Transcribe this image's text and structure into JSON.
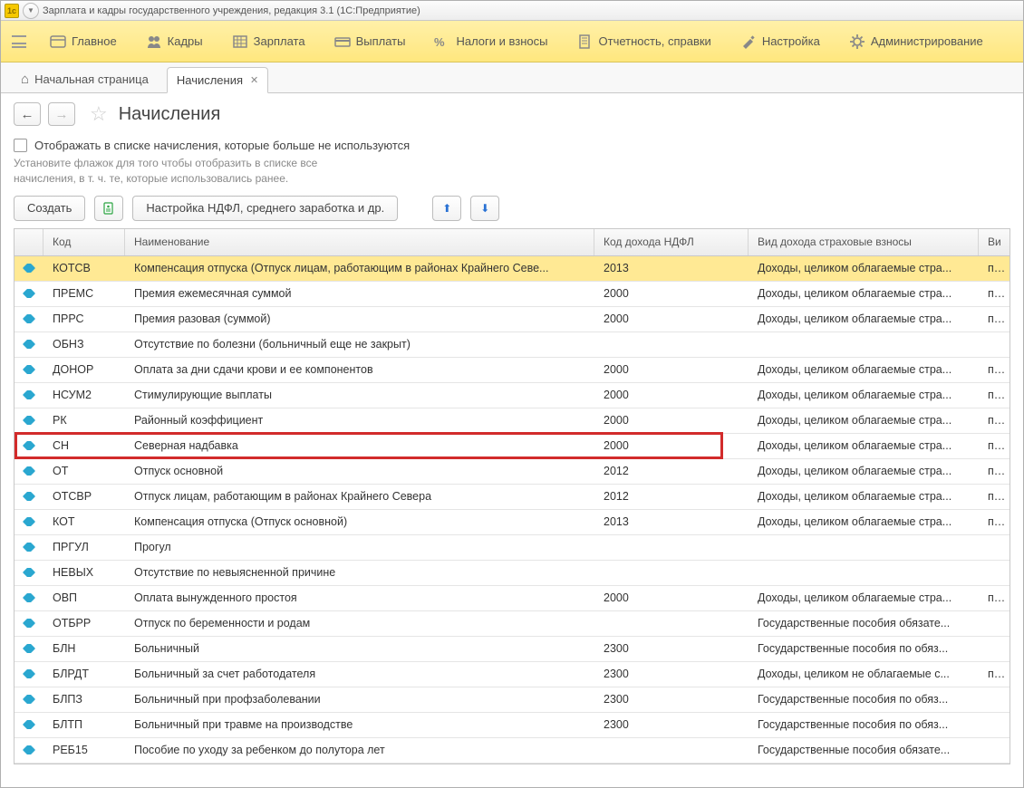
{
  "window": {
    "title": "Зарплата и кадры государственного учреждения, редакция 3.1  (1С:Предприятие)"
  },
  "menu": {
    "items": [
      {
        "label": "Главное"
      },
      {
        "label": "Кадры"
      },
      {
        "label": "Зарплата"
      },
      {
        "label": "Выплаты"
      },
      {
        "label": "Налоги и взносы"
      },
      {
        "label": "Отчетность, справки"
      },
      {
        "label": "Настройка"
      },
      {
        "label": "Администрирование"
      }
    ]
  },
  "tabs": {
    "home": "Начальная страница",
    "current": "Начисления"
  },
  "page": {
    "title": "Начисления",
    "checkbox_label": "Отображать в списке начисления, которые больше не используются",
    "hint": "Установите флажок для того чтобы отобразить в списке все начисления, в т. ч. те, которые использовались ранее."
  },
  "toolbar": {
    "create": "Создать",
    "settings": "Настройка НДФЛ, среднего заработка и др."
  },
  "columns": {
    "code": "Код",
    "name": "Наименование",
    "ndfl": "Код дохода НДФЛ",
    "insur": "Вид дохода страховые взносы",
    "vi": "Ви"
  },
  "rows": [
    {
      "code": "КОТСВ",
      "name": "Компенсация отпуска (Отпуск лицам, работающим в районах Крайнего Севе...",
      "ndfl": "2013",
      "insur": "Доходы, целиком облагаемые стра...",
      "vi": "пп...",
      "selected": true
    },
    {
      "code": "ПРЕМС",
      "name": "Премия ежемесячная суммой",
      "ndfl": "2000",
      "insur": "Доходы, целиком облагаемые стра...",
      "vi": "пп..."
    },
    {
      "code": "ПРРС",
      "name": "Премия разовая (суммой)",
      "ndfl": "2000",
      "insur": "Доходы, целиком облагаемые стра...",
      "vi": "пп..."
    },
    {
      "code": "ОБНЗ",
      "name": "Отсутствие по болезни (больничный еще не закрыт)",
      "ndfl": "",
      "insur": "",
      "vi": ""
    },
    {
      "code": "ДОНОР",
      "name": "Оплата за дни сдачи крови и ее компонентов",
      "ndfl": "2000",
      "insur": "Доходы, целиком облагаемые стра...",
      "vi": "пп..."
    },
    {
      "code": "НСУМ2",
      "name": "Стимулирующие выплаты",
      "ndfl": "2000",
      "insur": "Доходы, целиком облагаемые стра...",
      "vi": "пп..."
    },
    {
      "code": "РК",
      "name": "Районный коэффициент",
      "ndfl": "2000",
      "insur": "Доходы, целиком облагаемые стра...",
      "vi": "пп..."
    },
    {
      "code": "СН",
      "name": "Северная надбавка",
      "ndfl": "2000",
      "insur": "Доходы, целиком облагаемые стра...",
      "vi": "пп...",
      "highlight": true
    },
    {
      "code": "ОТ",
      "name": "Отпуск основной",
      "ndfl": "2012",
      "insur": "Доходы, целиком облагаемые стра...",
      "vi": "пп..."
    },
    {
      "code": "ОТСВР",
      "name": "Отпуск лицам, работающим в районах Крайнего Севера",
      "ndfl": "2012",
      "insur": "Доходы, целиком облагаемые стра...",
      "vi": "пп..."
    },
    {
      "code": "КОТ",
      "name": "Компенсация отпуска (Отпуск основной)",
      "ndfl": "2013",
      "insur": "Доходы, целиком облагаемые стра...",
      "vi": "пп..."
    },
    {
      "code": "ПРГУЛ",
      "name": "Прогул",
      "ndfl": "",
      "insur": "",
      "vi": ""
    },
    {
      "code": "НЕВЫХ",
      "name": "Отсутствие по невыясненной причине",
      "ndfl": "",
      "insur": "",
      "vi": ""
    },
    {
      "code": "ОВП",
      "name": "Оплата вынужденного простоя",
      "ndfl": "2000",
      "insur": "Доходы, целиком облагаемые стра...",
      "vi": "пп..."
    },
    {
      "code": "ОТБРР",
      "name": "Отпуск по беременности и родам",
      "ndfl": "",
      "insur": "Государственные пособия обязате...",
      "vi": ""
    },
    {
      "code": "БЛН",
      "name": "Больничный",
      "ndfl": "2300",
      "insur": "Государственные пособия по обяз...",
      "vi": ""
    },
    {
      "code": "БЛРДТ",
      "name": "Больничный за счет работодателя",
      "ndfl": "2300",
      "insur": "Доходы, целиком не облагаемые с...",
      "vi": "пп..."
    },
    {
      "code": "БЛПЗ",
      "name": "Больничный при профзаболевании",
      "ndfl": "2300",
      "insur": "Государственные пособия по обяз...",
      "vi": ""
    },
    {
      "code": "БЛТП",
      "name": "Больничный при травме на производстве",
      "ndfl": "2300",
      "insur": "Государственные пособия по обяз...",
      "vi": ""
    },
    {
      "code": "РЕБ15",
      "name": "Пособие по уходу за ребенком до полутора лет",
      "ndfl": "",
      "insur": "Государственные пособия обязате...",
      "vi": ""
    }
  ],
  "highlight_width": 782
}
